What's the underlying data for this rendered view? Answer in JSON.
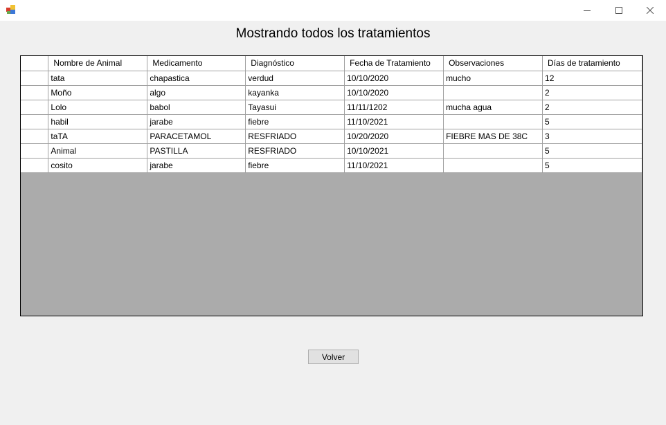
{
  "window": {
    "title": "",
    "controls": [
      "minimize-icon",
      "maximize-icon",
      "close-icon"
    ]
  },
  "form": {
    "title": "Mostrando todos los tratamientos"
  },
  "grid": {
    "columns": [
      "Nombre de Animal",
      "Medicamento",
      "Diagnóstico",
      "Fecha de Tratamiento",
      "Observaciones",
      "Días de tratamiento"
    ],
    "rows": [
      [
        "tata",
        "chapastica",
        "verdud",
        "10/10/2020",
        "mucho",
        "12"
      ],
      [
        "Moño",
        "algo",
        "kayanka",
        "10/10/2020",
        "",
        "2"
      ],
      [
        "Lolo",
        "babol",
        "Tayasui",
        "11/11/1202",
        "mucha agua",
        "2"
      ],
      [
        "habil",
        "jarabe",
        "fiebre",
        "11/10/2021",
        "",
        "5"
      ],
      [
        "taTA",
        "PARACETAMOL",
        "RESFRIADO",
        "10/20/2020",
        "FIEBRE MAS DE 38C",
        "3"
      ],
      [
        "Animal",
        "PASTILLA",
        "RESFRIADO",
        "10/10/2021",
        "",
        "5"
      ],
      [
        "cosito",
        "jarabe",
        "fiebre",
        "11/10/2021",
        "",
        "5"
      ]
    ],
    "background_color": "#ababab"
  },
  "buttons": {
    "volver_label": "Volver"
  }
}
